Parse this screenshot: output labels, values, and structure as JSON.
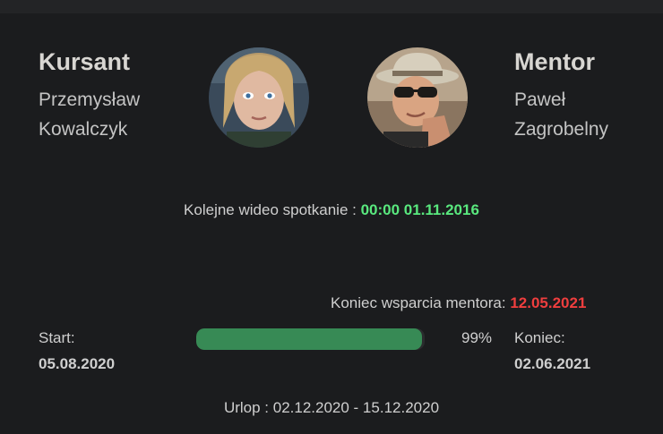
{
  "student": {
    "role": "Kursant",
    "first_name": "Przemysław",
    "last_name": "Kowalczyk"
  },
  "mentor": {
    "role": "Mentor",
    "first_name": "Paweł",
    "last_name": "Zagrobelny"
  },
  "meeting": {
    "label": "Kolejne wideo spotkanie : ",
    "value": "00:00 01.11.2016"
  },
  "support_end": {
    "label": "Koniec wsparcia mentora: ",
    "value": "12.05.2021"
  },
  "start": {
    "label": "Start:",
    "value": "05.08.2020"
  },
  "end": {
    "label": "Koniec:",
    "value": "02.06.2021"
  },
  "progress": {
    "fraction": 0.99,
    "label": "99%"
  },
  "vacation": {
    "text": "Urlop : 02.12.2020 - 15.12.2020"
  },
  "colors": {
    "accent_green": "#59e87e",
    "accent_red": "#ef3e3e",
    "progress_fill": "#378a55",
    "background": "#1b1c1e"
  }
}
